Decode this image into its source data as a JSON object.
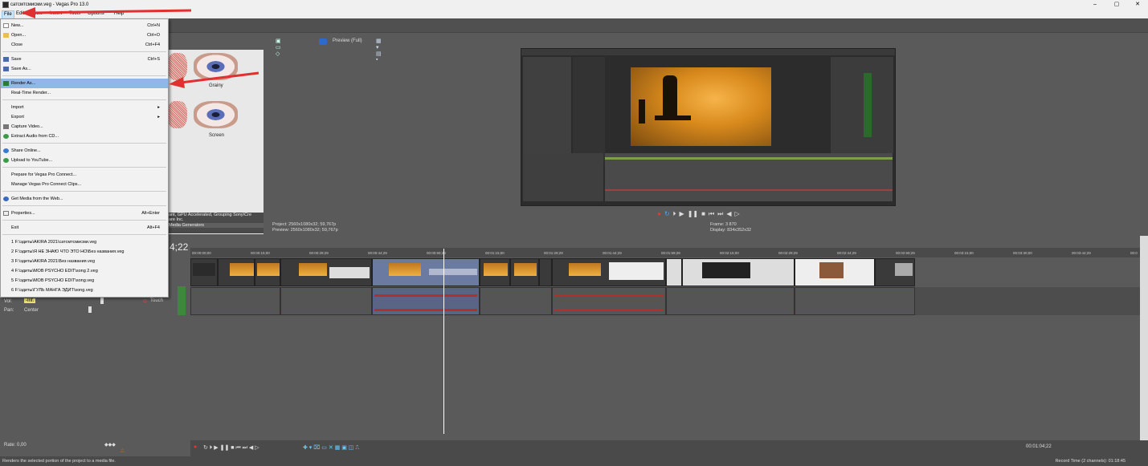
{
  "window": {
    "title": "сатсмтсмисми.veg - Vegas Pro 13.0",
    "controls": {
      "minimize": "–",
      "maximize": "▢",
      "close": "✕"
    }
  },
  "menubar": {
    "items": [
      "File",
      "Edit",
      "View",
      "Insert",
      "Tools",
      "Options",
      "Help"
    ]
  },
  "filemenu": {
    "items": [
      {
        "label": "New...",
        "shortcut": "Ctrl+N"
      },
      {
        "label": "Open...",
        "shortcut": "Ctrl+O"
      },
      {
        "label": "Close",
        "shortcut": "Ctrl+F4"
      },
      {
        "label": "Save",
        "shortcut": "Ctrl+S"
      },
      {
        "label": "Save As...",
        "shortcut": ""
      },
      {
        "label": "Render As...",
        "shortcut": ""
      },
      {
        "label": "Real-Time Render...",
        "shortcut": ""
      },
      {
        "label": "Import",
        "shortcut": "▸"
      },
      {
        "label": "Export",
        "shortcut": "▸"
      },
      {
        "label": "Capture Video...",
        "shortcut": ""
      },
      {
        "label": "Extract Audio from CD...",
        "shortcut": ""
      },
      {
        "label": "Share Online...",
        "shortcut": ""
      },
      {
        "label": "Upload to YouTube...",
        "shortcut": ""
      },
      {
        "label": "Prepare for Vegas Pro Connect...",
        "shortcut": ""
      },
      {
        "label": "Manage Vegas Pro Connect Clips...",
        "shortcut": ""
      },
      {
        "label": "Get Media from the Web...",
        "shortcut": ""
      },
      {
        "label": "Properties...",
        "shortcut": "Alt+Enter"
      },
      {
        "label": "Exit",
        "shortcut": "Alt+F4"
      }
    ],
    "recent": [
      "1 F:\\эдиты\\AKIRA 2021\\сатсмтсмисми.veg",
      "2 F:\\эдиты\\Я НЕ ЗНАЮ ЧТО ЭТО НО\\Без названия.veg",
      "3 F:\\эдиты\\AKIRA 2021\\Без названия.veg",
      "4 F:\\эдиты\\MOB PSYCHO EDIT\\song 2.veg",
      "5 F:\\эдиты\\MOB PSYCHO EDIT\\song.veg",
      "6 F:\\эдиты\\ГУЛЬ МАНГА ЭДИТ\\song.veg"
    ]
  },
  "fx": {
    "grainy": "Grainy",
    "screen": "Screen",
    "status_line1": "ant, GPU Accelerated, Grouping Sony\\Cre",
    "status_line2": "are Inc.",
    "tab": "Media Generators"
  },
  "preview": {
    "mode": "Preview (Full)",
    "project": "Project:  2560x1080x32; 59,767p",
    "preview_res": "Preview:  2560x1080x32; 59,767p",
    "frame": "Frame:   3 870",
    "display": "Display:   834x352x32"
  },
  "timeline": {
    "timecode": "4;22",
    "ruler": [
      "00:00:00;00",
      "00:00:15;00",
      "00:00:29;29",
      "00:00:44;29",
      "00:00:59;28",
      "00:01:15;00",
      "00:01:29;29",
      "00:01:44;29",
      "00:01:59;28",
      "00:02:15;00",
      "00:02:29;29",
      "00:02:44;29",
      "00:02:59;29",
      "00:03:15;00",
      "00:03:30;00",
      "00:03:44;29",
      "00:0"
    ],
    "vol_label": "Vol:",
    "vol_value": "-Inf.",
    "pan_label": "Pan:",
    "pan_value": "Center",
    "touch": "Touch",
    "rate": "Rate: 0,00",
    "record_time_code": "00:01:04;22",
    "record_time": "Record Time (2 channels): 01:18:45"
  },
  "status": {
    "text": "Renders the selected portion of the project to a media file."
  },
  "colors": {
    "highlight": "#8fb8e8",
    "arrow": "#e03030",
    "waveform": "#b03030"
  }
}
